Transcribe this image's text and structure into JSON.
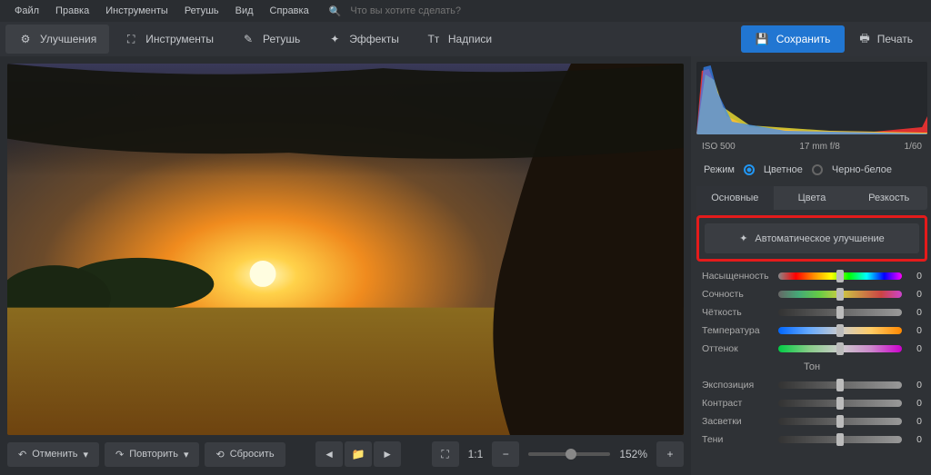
{
  "menu": {
    "items": [
      "Файл",
      "Правка",
      "Инструменты",
      "Ретушь",
      "Вид",
      "Справка"
    ],
    "search_placeholder": "Что вы хотите сделать?"
  },
  "toolbar": {
    "tabs": [
      "Улучшения",
      "Инструменты",
      "Ретушь",
      "Эффекты",
      "Надписи"
    ],
    "save": "Сохранить",
    "print": "Печать"
  },
  "bottom": {
    "undo": "Отменить",
    "redo": "Повторить",
    "reset": "Сбросить",
    "ratio": "1:1",
    "zoom": "152%"
  },
  "meta": {
    "iso": "ISO 500",
    "lens": "17 mm  f/8",
    "shutter": "1/60"
  },
  "mode": {
    "label": "Режим",
    "color": "Цветное",
    "bw": "Черно-белое"
  },
  "subtabs": [
    "Основные",
    "Цвета",
    "Резкость"
  ],
  "auto": "Автоматическое улучшение",
  "sliders": {
    "saturation": {
      "label": "Насыщенность",
      "val": "0"
    },
    "vibrance": {
      "label": "Сочность",
      "val": "0"
    },
    "clarity": {
      "label": "Чёткость",
      "val": "0"
    },
    "temperature": {
      "label": "Температура",
      "val": "0"
    },
    "tint": {
      "label": "Оттенок",
      "val": "0"
    },
    "tone_header": "Тон",
    "exposure": {
      "label": "Экспозиция",
      "val": "0"
    },
    "contrast": {
      "label": "Контраст",
      "val": "0"
    },
    "highlights": {
      "label": "Засветки",
      "val": "0"
    },
    "shadows": {
      "label": "Тени",
      "val": "0"
    }
  }
}
